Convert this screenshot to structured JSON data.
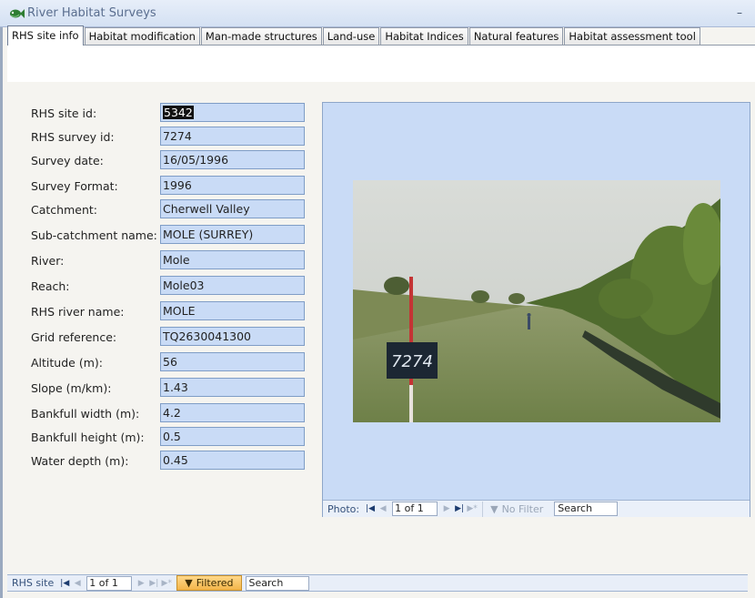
{
  "window": {
    "title": "River Habitat Surveys"
  },
  "tabs": [
    {
      "label": "RHS site info",
      "active": true
    },
    {
      "label": "Habitat modification",
      "active": false
    },
    {
      "label": "Man-made structures",
      "active": false
    },
    {
      "label": "Land-use",
      "active": false
    },
    {
      "label": "Habitat Indices",
      "active": false
    },
    {
      "label": "Natural features",
      "active": false
    },
    {
      "label": "Habitat assessment tool",
      "active": false
    }
  ],
  "fields": [
    {
      "label": "RHS site id:",
      "value": "5342"
    },
    {
      "label": "RHS survey id:",
      "value": "7274"
    },
    {
      "label": "Survey date:",
      "value": "16/05/1996"
    },
    {
      "label": "Survey Format:",
      "value": "1996"
    },
    {
      "label": "Catchment:",
      "value": "Cherwell Valley"
    },
    {
      "label": "Sub-catchment name:",
      "value": "MOLE (SURREY)"
    },
    {
      "label": "River:",
      "value": "Mole"
    },
    {
      "label": "Reach:",
      "value": "Mole03"
    },
    {
      "label": "RHS river name:",
      "value": "MOLE"
    },
    {
      "label": "Grid reference:",
      "value": "TQ2630041300"
    },
    {
      "label": "Altitude (m):",
      "value": "56"
    },
    {
      "label": "Slope (m/km):",
      "value": "1.43"
    },
    {
      "label": "Bankfull width (m):",
      "value": "4.2"
    },
    {
      "label": "Bankfull height (m):",
      "value": "0.5"
    },
    {
      "label": "Water depth (m):",
      "value": "0.45"
    }
  ],
  "photo": {
    "sign_text": "7274"
  },
  "photo_nav": {
    "label": "Photo:",
    "position": "1 of 1",
    "filter": "No Filter",
    "search": "Search"
  },
  "record_nav": {
    "label": "RHS site",
    "position": "1 of 1",
    "filter": "Filtered",
    "search": "Search"
  },
  "colors": {
    "field_bg": "#c9dbf6",
    "filter_active": "#f3b54a"
  }
}
